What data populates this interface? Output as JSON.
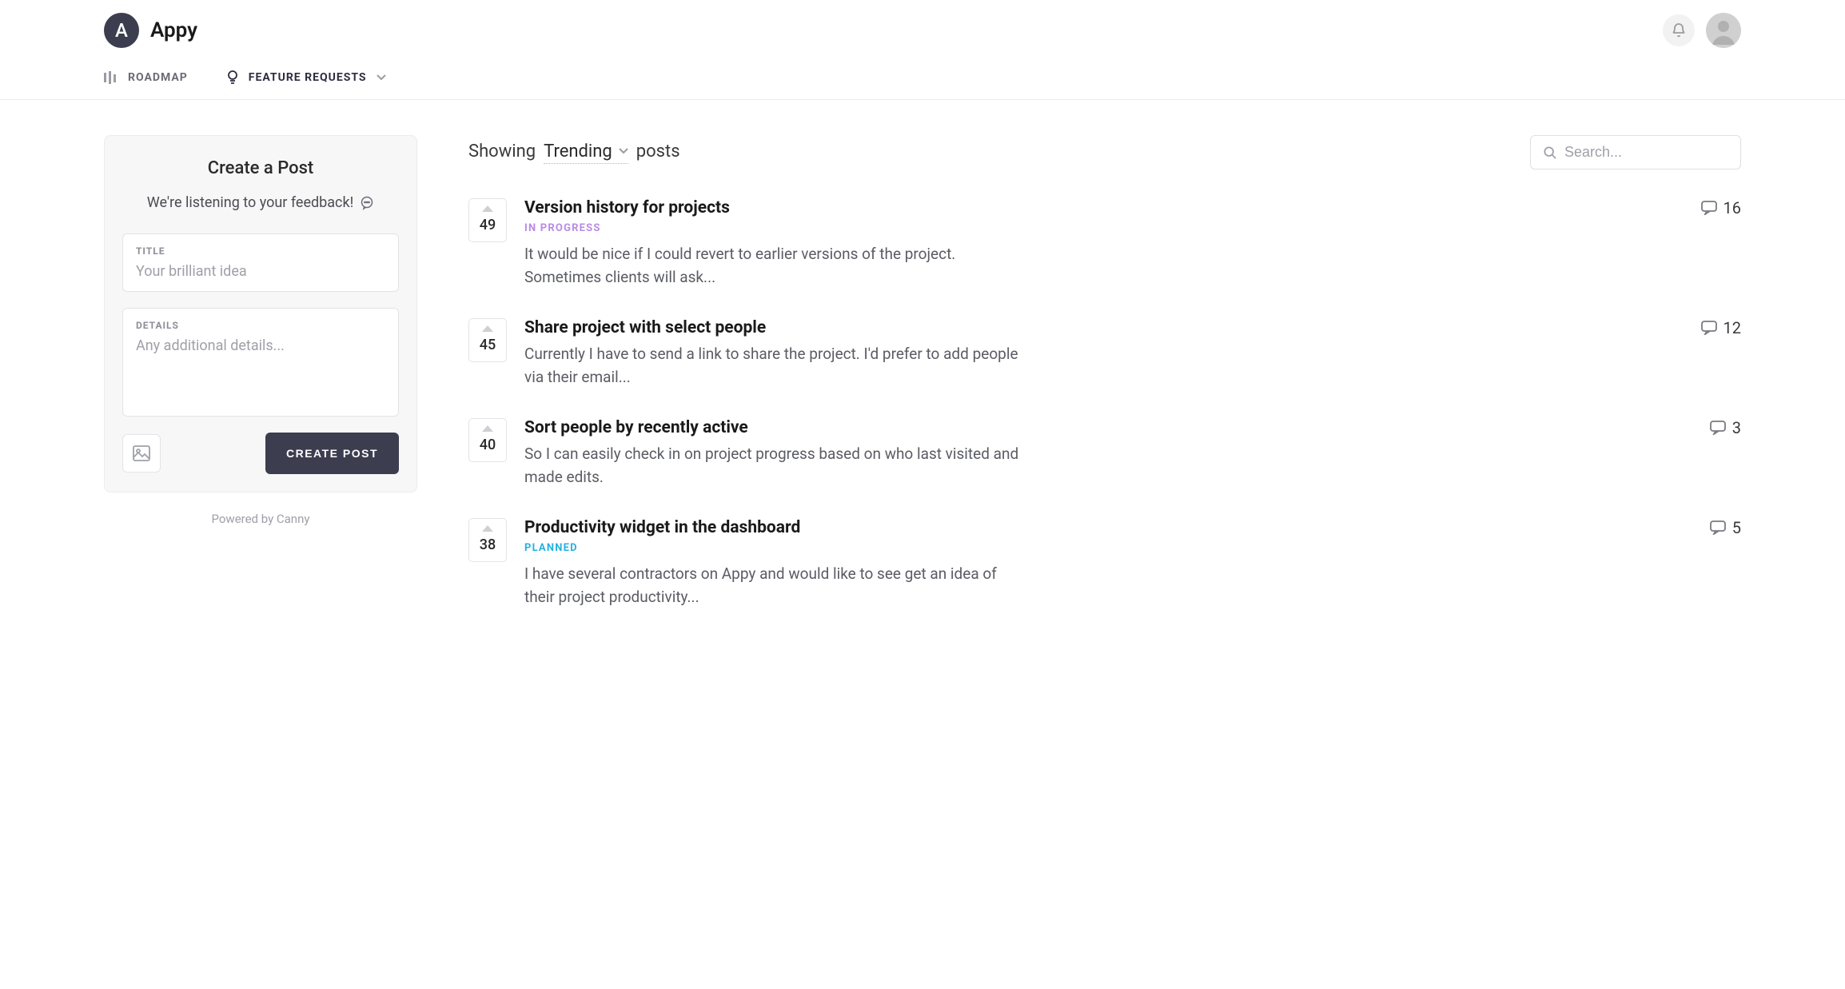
{
  "app": {
    "name": "Appy",
    "logo_letter": "A"
  },
  "nav": {
    "roadmap": "ROADMAP",
    "feature_requests": "FEATURE REQUESTS"
  },
  "create": {
    "title": "Create a Post",
    "subtitle": "We're listening to your feedback!",
    "title_label": "TITLE",
    "title_placeholder": "Your brilliant idea",
    "details_label": "DETAILS",
    "details_placeholder": "Any additional details...",
    "button": "CREATE POST"
  },
  "footer": {
    "powered": "Powered by Canny"
  },
  "filter": {
    "showing": "Showing",
    "selected": "Trending",
    "posts": "posts"
  },
  "search": {
    "placeholder": "Search..."
  },
  "posts": [
    {
      "votes": "49",
      "title": "Version history for projects",
      "status": "IN PROGRESS",
      "status_class": "in-progress",
      "desc": "It would be nice if I could revert to earlier versions of the project. Sometimes clients will ask...",
      "comments": "16"
    },
    {
      "votes": "45",
      "title": "Share project with select people",
      "status": "",
      "status_class": "",
      "desc": "Currently I have to send a link to share the project. I'd prefer to add people via their email...",
      "comments": "12"
    },
    {
      "votes": "40",
      "title": "Sort people by recently active",
      "status": "",
      "status_class": "",
      "desc": "So I can easily check in on project progress based on who last visited and made edits.",
      "comments": "3"
    },
    {
      "votes": "38",
      "title": "Productivity widget in the dashboard",
      "status": "PLANNED",
      "status_class": "planned",
      "desc": "I have several contractors on Appy and would like to see get an idea of their project productivity...",
      "comments": "5"
    }
  ]
}
